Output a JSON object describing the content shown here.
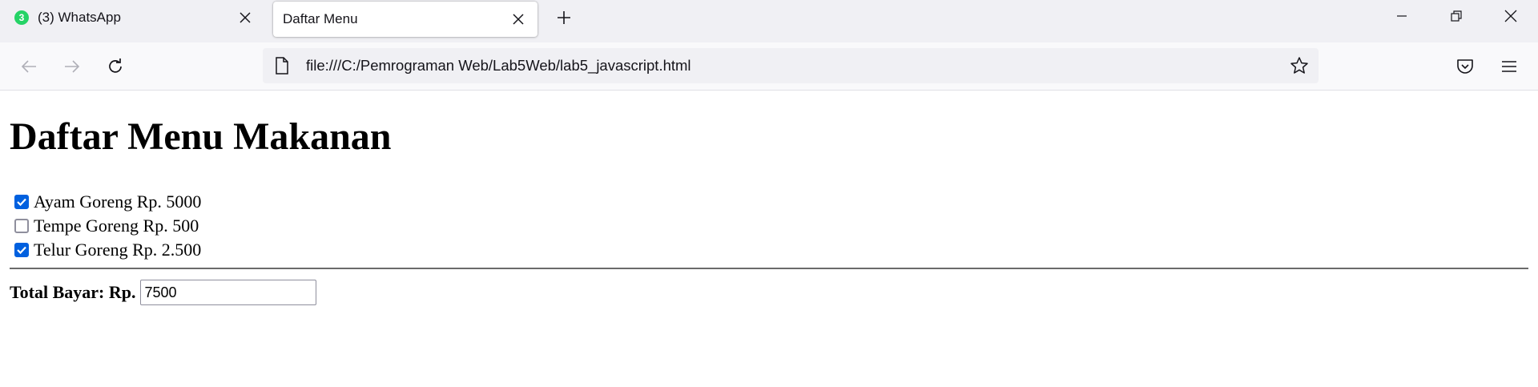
{
  "tabs": [
    {
      "title": "(3) WhatsApp",
      "badge": "3",
      "badge_color": "#25d366"
    },
    {
      "title": "Daftar Menu"
    }
  ],
  "icons": {
    "back": "arrow-left-icon",
    "forward": "arrow-right-icon",
    "reload": "reload-icon",
    "page": "page-icon",
    "bookmark": "star-icon",
    "pocket": "pocket-icon",
    "menu": "hamburger-icon"
  },
  "address_bar": {
    "url": "file:///C:/Pemrograman Web/Lab5Web/lab5_javascript.html"
  },
  "page": {
    "title": "Daftar Menu Makanan",
    "menu_items": [
      {
        "label": "Ayam Goreng Rp. 5000",
        "checked": true
      },
      {
        "label": "Tempe Goreng Rp. 500",
        "checked": false
      },
      {
        "label": "Telur Goreng Rp. 2.500",
        "checked": true
      }
    ],
    "total_label": "Total Bayar: Rp.",
    "total_value": "7500"
  },
  "colors": {
    "checkbox_accent": "#0060df",
    "tab_strip_bg": "#f0f0f4",
    "nav_bg": "#f9f9fb"
  }
}
